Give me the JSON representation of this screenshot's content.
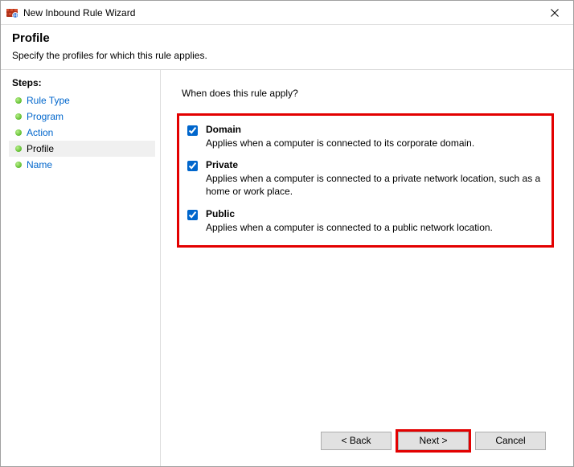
{
  "window": {
    "title": "New Inbound Rule Wizard"
  },
  "header": {
    "title": "Profile",
    "subtitle": "Specify the profiles for which this rule applies."
  },
  "sidebar": {
    "heading": "Steps:",
    "items": [
      {
        "label": "Rule Type"
      },
      {
        "label": "Program"
      },
      {
        "label": "Action"
      },
      {
        "label": "Profile"
      },
      {
        "label": "Name"
      }
    ]
  },
  "content": {
    "question": "When does this rule apply?",
    "profiles": [
      {
        "label": "Domain",
        "description": "Applies when a computer is connected to its corporate domain."
      },
      {
        "label": "Private",
        "description": "Applies when a computer is connected to a private network location, such as a home or work place."
      },
      {
        "label": "Public",
        "description": "Applies when a computer is connected to a public network location."
      }
    ]
  },
  "footer": {
    "back": "< Back",
    "next": "Next >",
    "cancel": "Cancel"
  }
}
